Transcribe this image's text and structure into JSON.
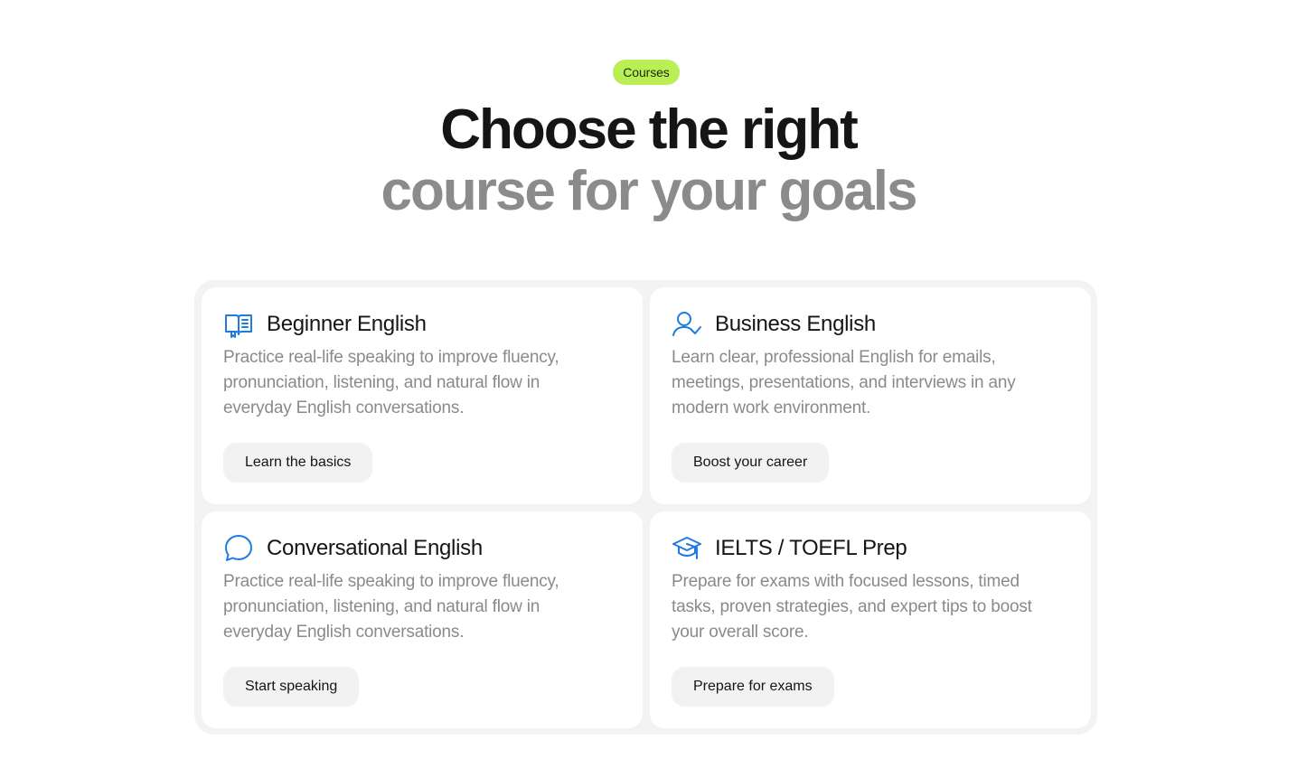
{
  "badge": {
    "label": "Courses",
    "color": "#b9ef55"
  },
  "headline": {
    "line1": "Choose the right",
    "line2": "course for your goals"
  },
  "accent_color": "#1e7be0",
  "courses": [
    {
      "icon": "open-book-icon",
      "title": "Beginner English",
      "description": "Practice real-life speaking to improve fluency, pronunciation, listening, and natural flow in everyday English conversations.",
      "button": "Learn the basics"
    },
    {
      "icon": "user-check-icon",
      "title": "Business English",
      "description": "Learn clear, professional English for emails, meetings, presentations, and interviews in any modern work environment.",
      "button": "Boost your career"
    },
    {
      "icon": "chat-bubble-icon",
      "title": "Conversational English",
      "description": "Practice real-life speaking to improve fluency, pronunciation, listening, and natural flow in everyday English conversations.",
      "button": "Start speaking"
    },
    {
      "icon": "graduation-cap-icon",
      "title": "IELTS / TOEFL Prep",
      "description": "Prepare for exams with focused lessons, timed tasks, proven strategies, and expert tips to boost your overall score.",
      "button": "Prepare for exams"
    }
  ]
}
